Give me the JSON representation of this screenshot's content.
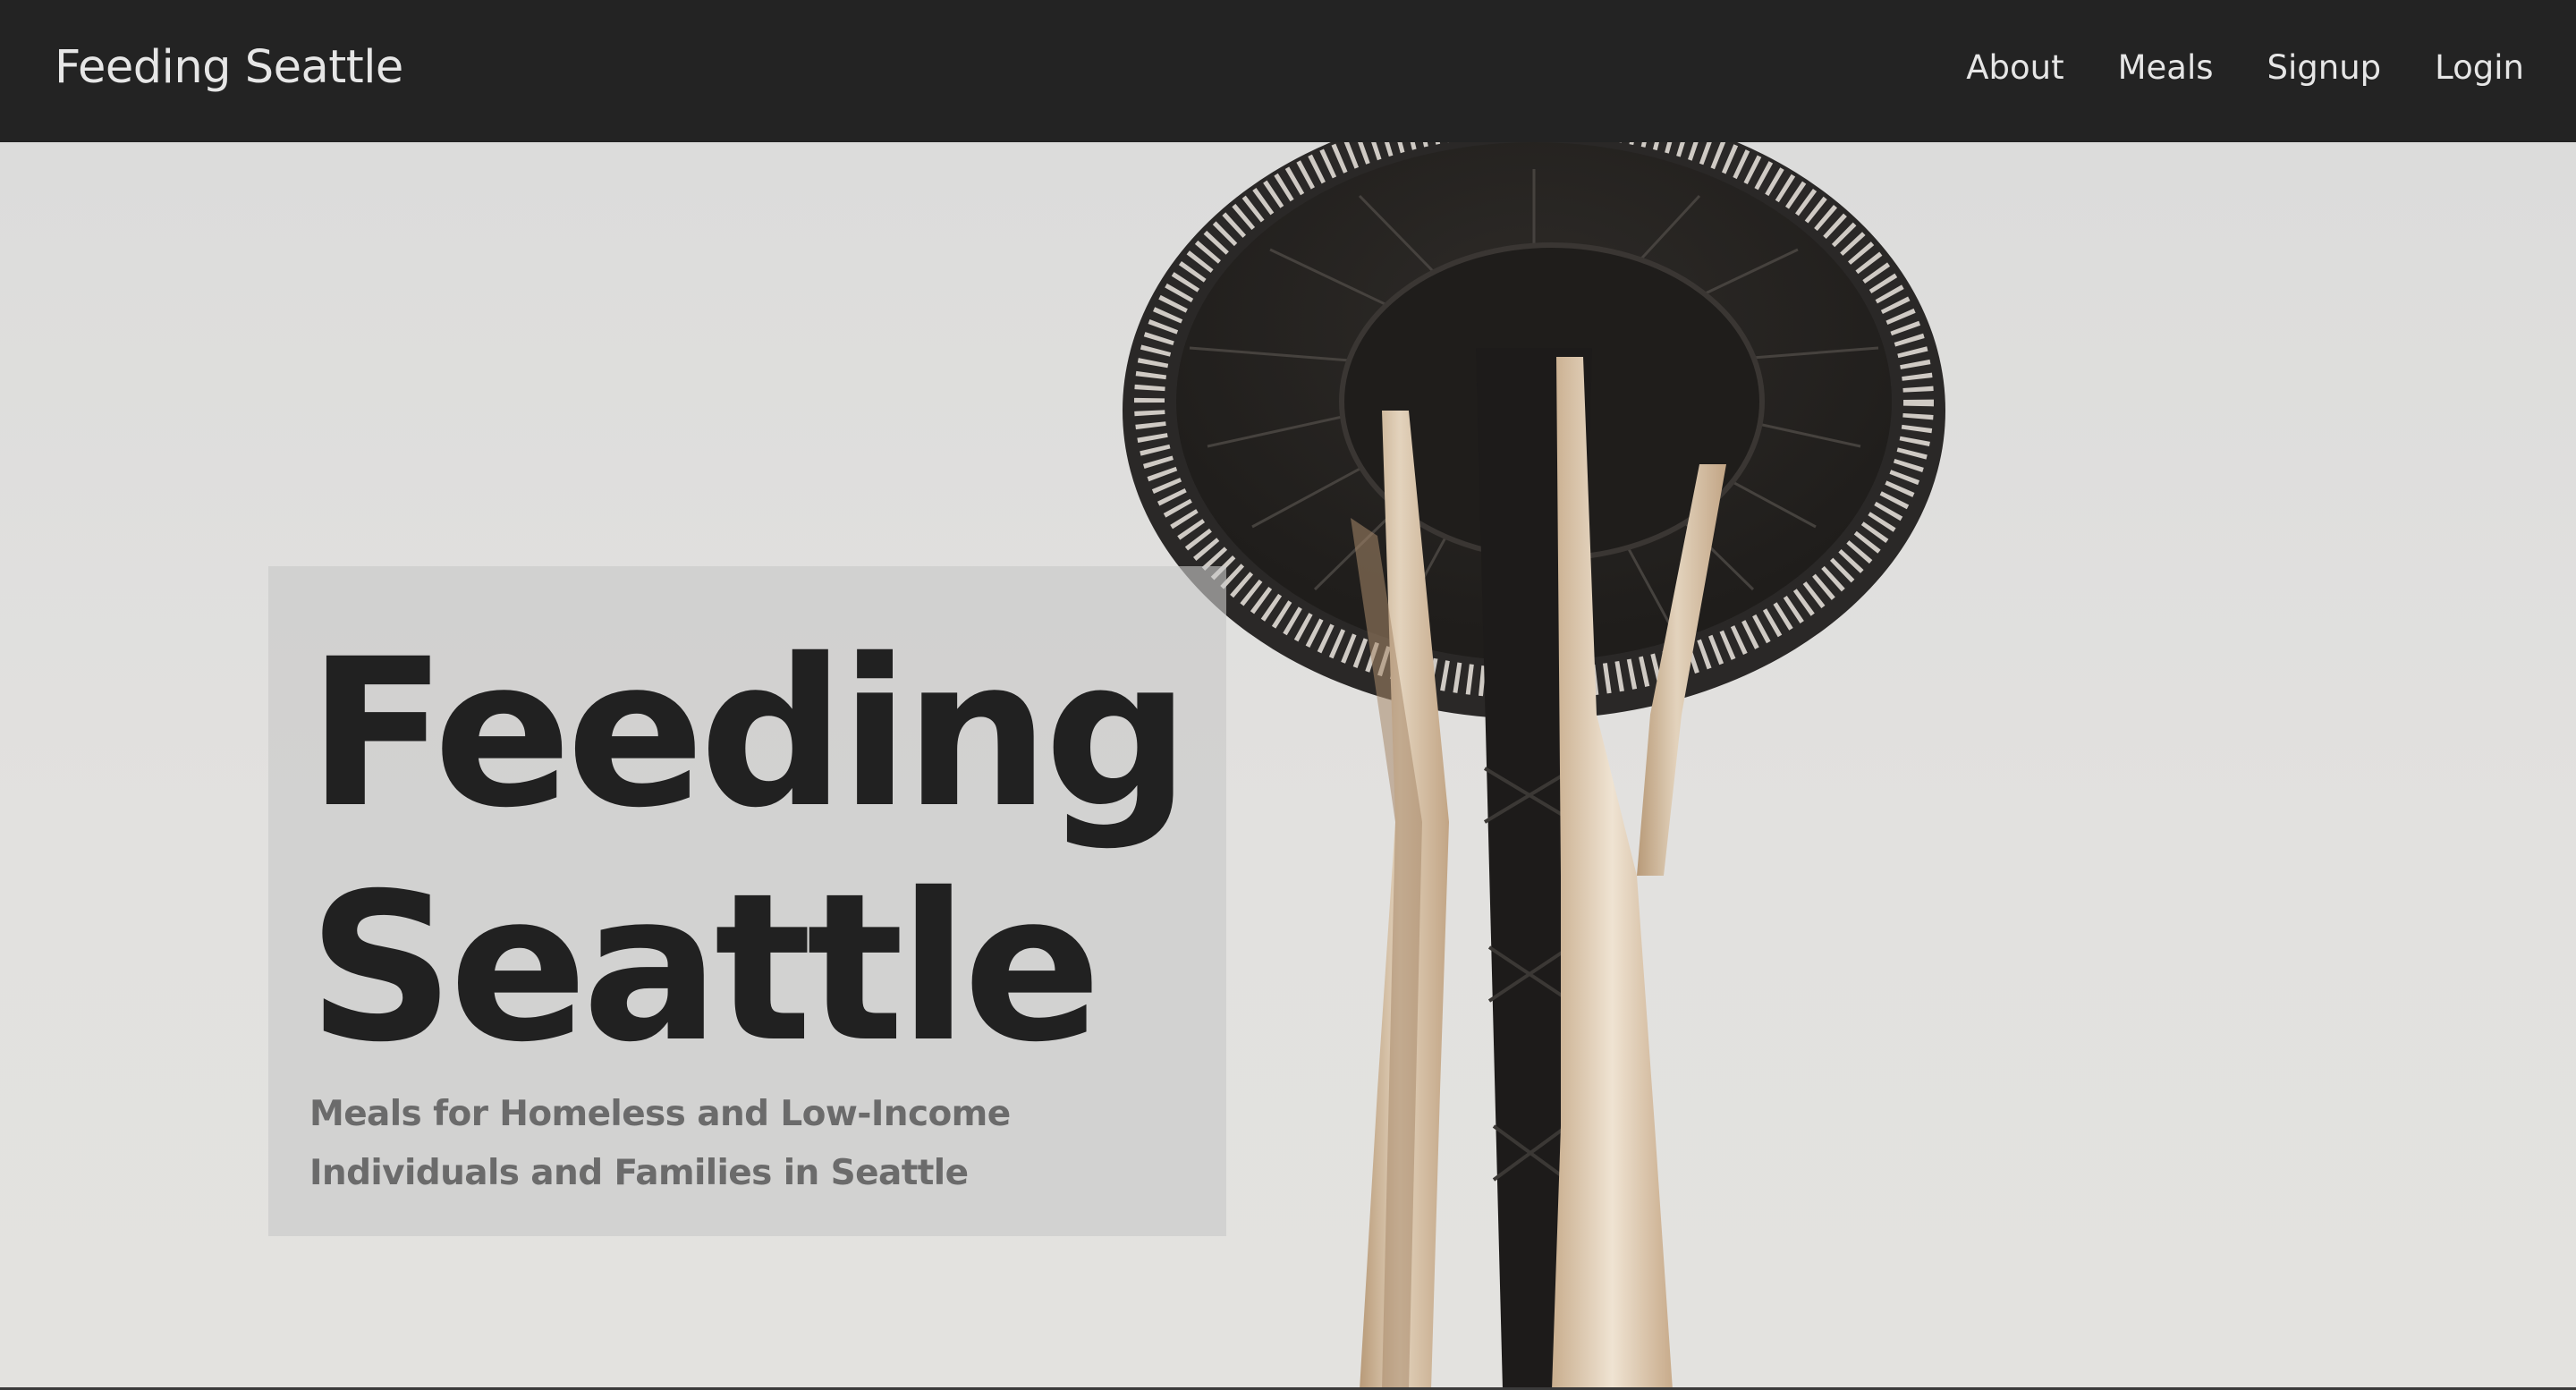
{
  "navbar": {
    "brand": "Feeding Seattle",
    "links": [
      "About",
      "Meals",
      "Signup",
      "Login"
    ]
  },
  "hero": {
    "title_line1": "Feeding",
    "title_line2": "Seattle",
    "subtitle": "Meals for Homeless and Low-Income Individuals and Families in Seattle",
    "background_image": "space-needle-photo"
  },
  "colors": {
    "navbar_bg": "#232323",
    "nav_text": "#e6e6e6",
    "hero_bg": "#dedddb",
    "title_text": "#212121",
    "subtitle_text": "#6b6b6b"
  }
}
